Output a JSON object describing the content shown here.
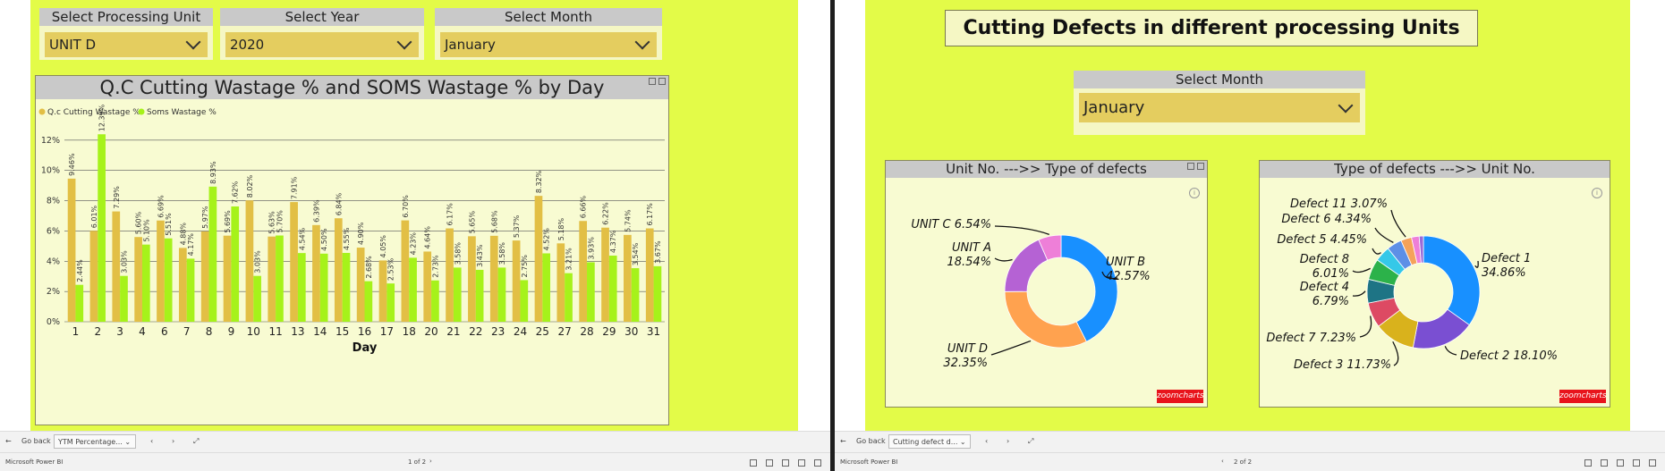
{
  "win1": {
    "slicers": [
      {
        "header": "Select Processing Unit",
        "value": "UNIT D"
      },
      {
        "header": "Select Year",
        "value": "2020"
      },
      {
        "header": "Select Month",
        "value": "January"
      }
    ],
    "bottom": {
      "back": "Go back",
      "tab": "YTM Percentage...",
      "page": "1 of 2",
      "app": "Microsoft Power BI"
    }
  },
  "win2": {
    "title": "Cutting Defects in different processing  Units",
    "slicer": {
      "header": "Select Month",
      "value": "January"
    },
    "donut1_title": "Unit No. --->> Type of defects",
    "donut2_title": "Type of defects --->> Unit No.",
    "logo": "zoomcharts",
    "bottom": {
      "back": "Go back",
      "tab": "Cutting defect d...",
      "page": "2 of 2",
      "app": "Microsoft Power BI"
    }
  },
  "colors": {
    "qc": "#e2bf45",
    "soms": "#a6f21a",
    "canvas": "#e3fb48"
  },
  "chart_data": [
    {
      "type": "bar",
      "title": "Q.C Cutting Wastage % and SOMS Wastage % by Day",
      "xlabel": "Day",
      "ylabel": "",
      "ylim": [
        0,
        14
      ],
      "yticks": [
        "0%",
        "2%",
        "4%",
        "6%",
        "8%",
        "10%",
        "12%"
      ],
      "categories": [
        "1",
        "2",
        "3",
        "4",
        "6",
        "7",
        "8",
        "9",
        "10",
        "11",
        "13",
        "14",
        "15",
        "16",
        "17",
        "18",
        "20",
        "21",
        "22",
        "23",
        "24",
        "25",
        "27",
        "28",
        "29",
        "30",
        "31"
      ],
      "series": [
        {
          "name": "Q.c Cutting Wastage %",
          "values": [
            9.46,
            6.01,
            7.29,
            5.6,
            6.69,
            4.88,
            5.97,
            5.69,
            8.02,
            5.63,
            7.91,
            6.39,
            6.84,
            4.9,
            4.05,
            6.7,
            4.64,
            6.17,
            5.65,
            5.68,
            5.37,
            8.32,
            5.18,
            6.66,
            6.22,
            5.74,
            6.17
          ]
        },
        {
          "name": "Soms Wastage %",
          "values": [
            2.44,
            12.39,
            3.03,
            5.1,
            5.51,
            4.17,
            8.93,
            7.62,
            3.03,
            5.7,
            4.54,
            4.5,
            4.55,
            2.68,
            2.53,
            4.23,
            2.73,
            3.58,
            3.43,
            3.58,
            2.75,
            4.52,
            3.21,
            3.93,
            4.37,
            3.54,
            3.67
          ]
        }
      ],
      "labels": {
        "qc": [
          "9.46%",
          "6.01%",
          "7.29%",
          "5.60%",
          "6.69%",
          "4.88%",
          "5.97%",
          "5.69%",
          "8.02%",
          "5.63%",
          "7.91%",
          "6.39%",
          "6.84%",
          "4.90%",
          "4.05%",
          "6.70%",
          "4.64%",
          "6.17%",
          "5.65%",
          "5.68%",
          "5.37%",
          "8.32%",
          "5.18%",
          "6.66%",
          "6.22%",
          "5.74%",
          "6.17%"
        ],
        "soms": [
          "2.44%",
          "12.39%",
          "3.03%",
          "5.10%",
          "5.51%",
          "4.17%",
          "8.93%",
          "7.62%",
          "3.03%",
          "5.70%",
          "4.54%",
          "4.50%",
          "4.55%",
          "2.68%",
          "2.53%",
          "4.23%",
          "2.73%",
          "3.58%",
          "3.43%",
          "3.58%",
          "2.75%",
          "4.52%",
          "3.21%",
          "3.93%",
          "4.37%",
          "3.54%",
          "3.67%"
        ]
      },
      "legend": "top-left",
      "grid": true
    },
    {
      "type": "pie",
      "title": "Unit No. --->> Type of defects",
      "slices": [
        {
          "name": "UNIT B",
          "value": 42.57,
          "label": "42.57%",
          "color": "#1890ff"
        },
        {
          "name": "UNIT D",
          "value": 32.35,
          "label": "32.35%",
          "color": "#ffa24f"
        },
        {
          "name": "UNIT A",
          "value": 18.54,
          "label": "18.54%",
          "color": "#b562d4"
        },
        {
          "name": "UNIT C",
          "value": 6.54,
          "label": "6.54%",
          "color": "#ee7fd8"
        }
      ]
    },
    {
      "type": "pie",
      "title": "Type of defects --->> Unit No.",
      "slices": [
        {
          "name": "Defect 1",
          "value": 34.86,
          "label": "34.86%",
          "color": "#1890ff"
        },
        {
          "name": "Defect 2",
          "value": 18.1,
          "label": "18.10%",
          "color": "#7a4fd2"
        },
        {
          "name": "Defect 3",
          "value": 11.73,
          "label": "11.73%",
          "color": "#d9b21c"
        },
        {
          "name": "Defect 7",
          "value": 7.23,
          "label": "7.23%",
          "color": "#dd4a63"
        },
        {
          "name": "Defect 4",
          "value": 6.79,
          "label": "6.79%",
          "color": "#1e7485"
        },
        {
          "name": "Defect 8",
          "value": 6.01,
          "label": "6.01%",
          "color": "#2cb24a"
        },
        {
          "name": "Defect 5",
          "value": 4.45,
          "label": "4.45%",
          "color": "#35c8e8"
        },
        {
          "name": "Defect 6",
          "value": 4.34,
          "label": "4.34%",
          "color": "#5d8fe6"
        },
        {
          "name": "Defect 11",
          "value": 3.07,
          "label": "3.07%",
          "color": "#f5a25a"
        },
        {
          "name": "",
          "value": 2.2,
          "label": "",
          "color": "#ee7fd8"
        },
        {
          "name": "",
          "value": 1.22,
          "label": "",
          "color": "#9b6ad8"
        }
      ]
    }
  ]
}
